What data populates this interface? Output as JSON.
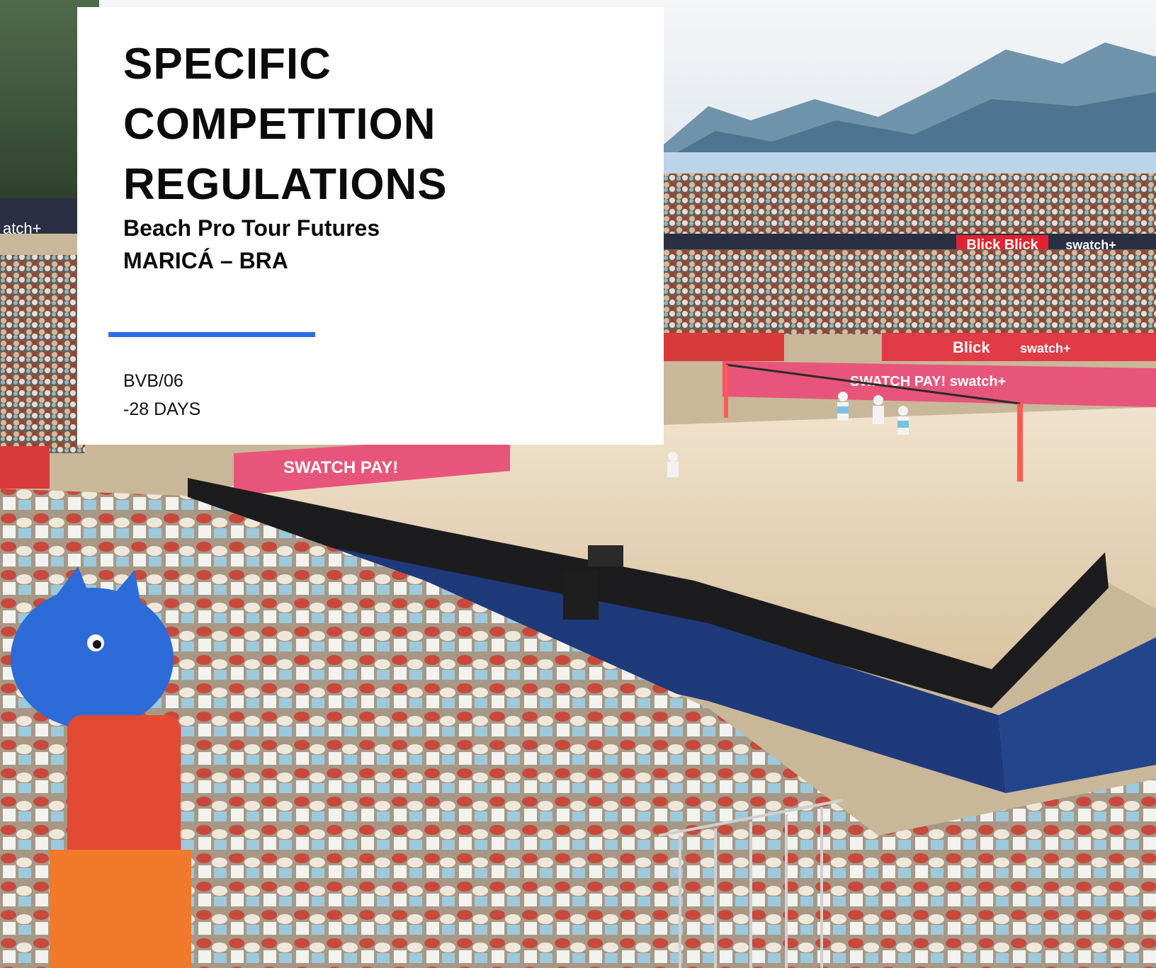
{
  "document": {
    "title_lines": [
      "SPECIFIC",
      "COMPETITION",
      "REGULATIONS"
    ],
    "subtitle_lines": [
      "Beach Pro Tour Futures",
      "MARICÁ – BRA"
    ],
    "reference_code": "BVB/06",
    "deadline": "-28 DAYS"
  },
  "theme": {
    "card_background": "#ffffff",
    "accent_rule": "#2f6be8",
    "text": "#0b0b0b"
  },
  "photo": {
    "banners": [
      "Blick",
      "Blick",
      "swatch+",
      "SWATCH PAY!",
      "swatch+",
      "Blick",
      "swatch+"
    ]
  }
}
